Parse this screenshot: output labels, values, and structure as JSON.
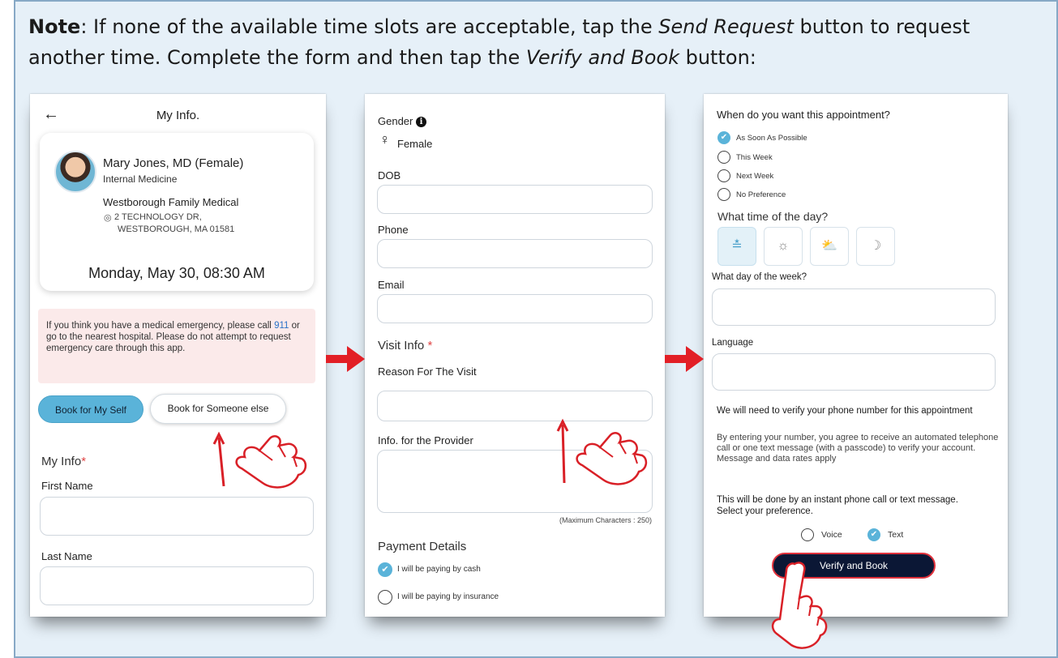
{
  "note": {
    "bold_label": "Note",
    "text_1": ": If none of the available time slots are acceptable, tap the ",
    "italic_1": "Send Request",
    "text_2": " button to request another time. Complete the form and then tap the ",
    "italic_2": "Verify and Book",
    "text_3": " button:"
  },
  "screen1": {
    "title": "My Info.",
    "doctor": {
      "name": "Mary Jones, MD (Female)",
      "specialty": "Internal Medicine",
      "clinic": "Westborough Family Medical",
      "address_line1": "2 TECHNOLOGY DR,",
      "address_line2": "WESTBOROUGH, MA 01581",
      "appointment": "Monday, May 30, 08:30 AM"
    },
    "emergency": {
      "text_1": "If you think you have a medical emergency, please call ",
      "number": "911",
      "text_2": " or go to the nearest hospital. Please do not attempt to request emergency care through this app."
    },
    "book_self": "Book for My Self",
    "book_else": "Book for Someone else",
    "section_title": "My Info",
    "required_mark": "*",
    "first_name_label": "First Name",
    "last_name_label": "Last Name"
  },
  "screen2": {
    "gender_label": "Gender",
    "gender_value": "Female",
    "dob_label": "DOB",
    "phone_label": "Phone",
    "email_label": "Email",
    "visit_info_title": "Visit Info",
    "required_mark": "*",
    "reason_label": "Reason For The Visit",
    "provider_info_label": "Info. for the Provider",
    "max_chars": "(Maximum Characters : 250)",
    "payment_title": "Payment Details",
    "pay_cash": "I will be paying by cash",
    "pay_insurance": "I will be paying by insurance"
  },
  "screen3": {
    "when_question": "When do you want this appointment?",
    "when_options": [
      "As Soon As Possible",
      "This Week",
      "Next Week",
      "No Preference"
    ],
    "time_question": "What time of the day?",
    "time_icons": [
      "all-day-icon",
      "morning-sun-icon",
      "afternoon-cloud-sun-icon",
      "evening-moon-icon"
    ],
    "day_label": "What day of the week?",
    "language_label": "Language",
    "verify_title": "We will need to verify your phone number for this appointment",
    "verify_desc": "By entering your number, you agree to receive an automated telephone call or one text message (with a passcode) to verify your account.  Message and data rates apply",
    "method_text": "This will be done by an instant phone call or text message. Select your preference.",
    "voice_label": "Voice",
    "text_label": "Text",
    "verify_button": "Verify and Book"
  },
  "colors": {
    "accent": "#5ab3d9",
    "highlight_red": "#e0323c",
    "note_bg": "#e6f0f8",
    "verify_btn": "#0b1735"
  }
}
